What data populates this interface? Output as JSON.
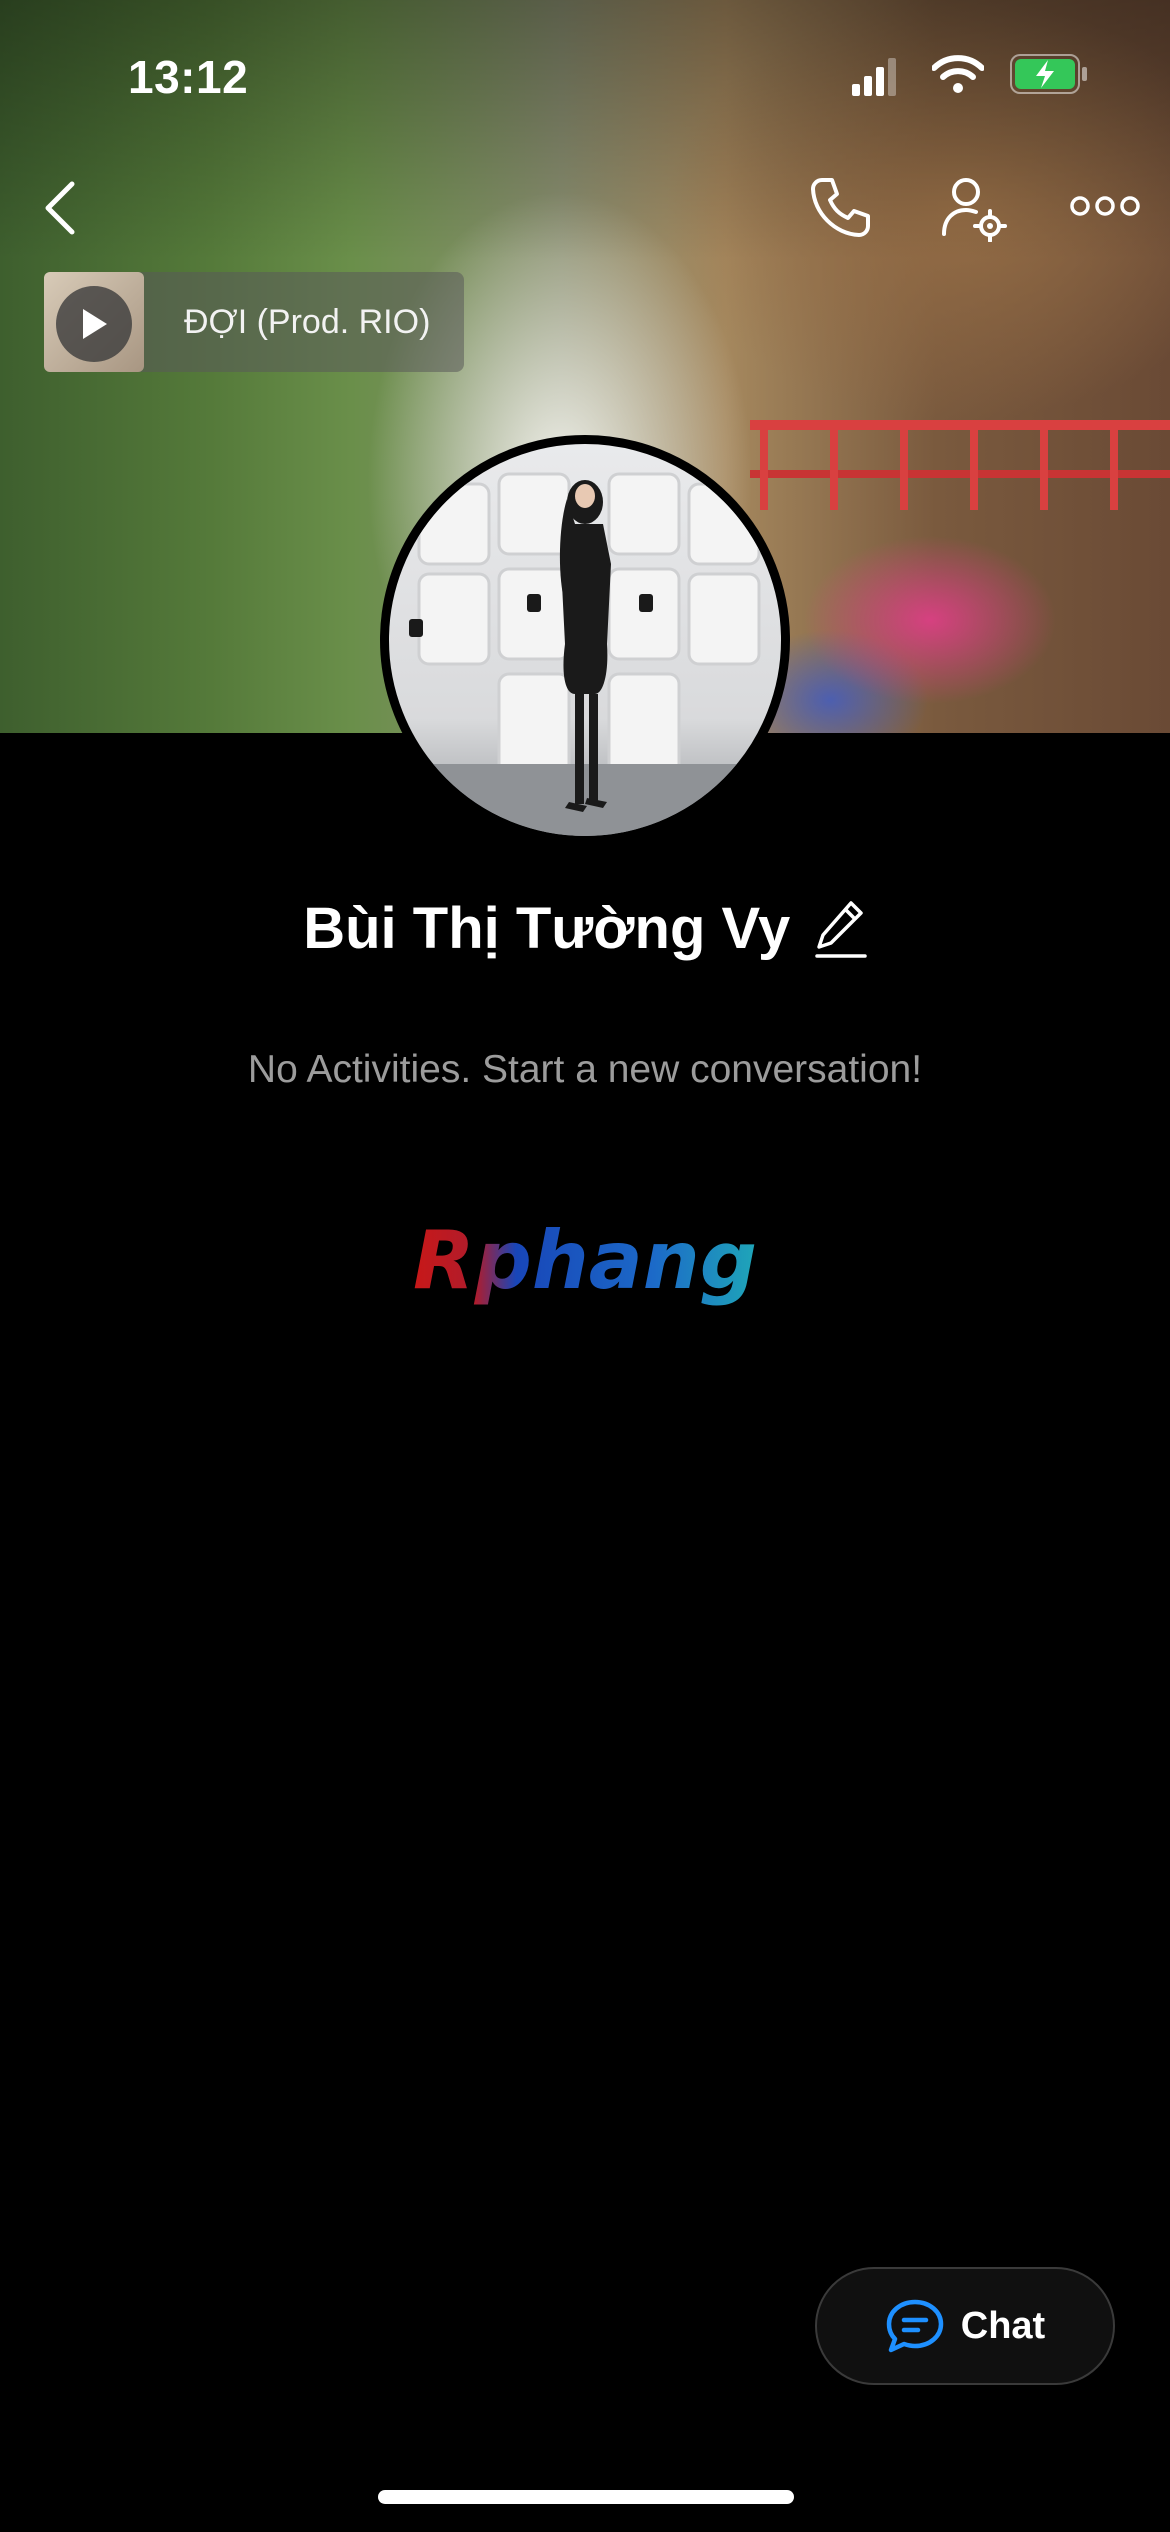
{
  "status_bar": {
    "time": "13:12",
    "icons": [
      "cellular-signal-icon",
      "wifi-icon",
      "battery-charging-icon"
    ]
  },
  "header": {
    "icons": [
      "back-chevron-icon",
      "phone-call-icon",
      "profile-settings-icon",
      "more-options-icon"
    ]
  },
  "music": {
    "title": "ĐỢI (Prod. RIO)",
    "icon": "play-icon"
  },
  "profile": {
    "name": "Bùi Thị Tường Vy",
    "edit_icon": "pencil-icon",
    "activity_text": "No Activities. Start a new conversation!"
  },
  "watermark": {
    "text": "Rphang"
  },
  "chat_button": {
    "label": "Chat",
    "icon": "chat-bubble-icon"
  },
  "colors": {
    "background": "#000000",
    "accent": "#1e90ff",
    "battery": "#34c759",
    "secondary_text": "#9c9c9c"
  }
}
